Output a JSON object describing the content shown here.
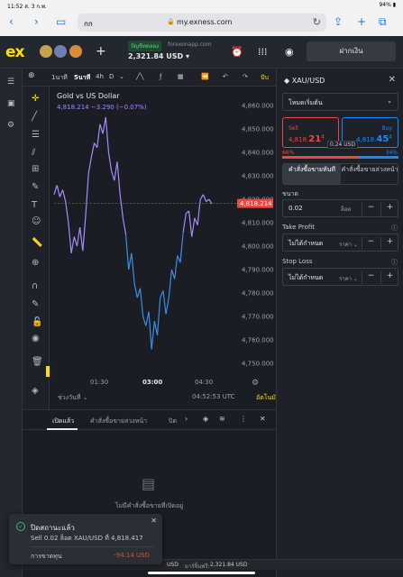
{
  "status": {
    "time": "11:52",
    "date": "ส. 3 ก.พ.",
    "battery": "94%"
  },
  "browser": {
    "aa": "กก",
    "url": "my.exness.com"
  },
  "header": {
    "account_badge": "ปัญชีทดลอง",
    "server": "forexonapp.com",
    "balance": "2,321.84 USD",
    "deposit_label": "ฝากเงิน"
  },
  "toolbar": {
    "tf_1m": "1นาที",
    "tf_5m": "5นาที",
    "tf_4h": "4h",
    "tf_d": "D",
    "right_label": "ปับ"
  },
  "chart": {
    "title": "Gold vs US Dollar",
    "quote": "4,818.214  −3.290 (−0.07%)",
    "time_range_label": "ช่วงวันที่",
    "clock": "04:52:53 UTC",
    "autoscale_label": "อัตโนมัติ",
    "current_price_label": "4,818.214"
  },
  "chart_data": {
    "type": "line",
    "title": "Gold vs US Dollar",
    "x_ticks": [
      "01:30",
      "03:00",
      "04:30"
    ],
    "y_ticks": [
      "4,860.000",
      "4,850.000",
      "4,840.000",
      "4,830.000",
      "4,820.000",
      "4,810.000",
      "4,800.000",
      "4,790.000",
      "4,780.000",
      "4,770.000",
      "4,760.000",
      "4,750.000"
    ],
    "ylim": [
      4745,
      4865
    ],
    "current_price": 4818.214,
    "series": [
      {
        "values": [
          4822,
          4826,
          4821,
          4824,
          4819,
          4810,
          4797,
          4804,
          4800,
          4808,
          4798,
          4813,
          4831,
          4838,
          4844,
          4842,
          4852,
          4848,
          4855,
          4840,
          4832,
          4828,
          4836,
          4822,
          4812,
          4805,
          4790,
          4797,
          4784,
          4778,
          4782,
          4770,
          4766,
          4772,
          4756,
          4768,
          4762,
          4778,
          4781,
          4771,
          4778,
          4790,
          4786,
          4796,
          4793,
          4806,
          4814,
          4815,
          4804,
          4812,
          4809,
          4820,
          4822,
          4819,
          4820,
          4818
        ]
      }
    ]
  },
  "panel": {
    "symbol": "XAU/USD",
    "mode": "โหมดเริ่มต้น",
    "sell_label": "Sell",
    "sell_price_small": "4,818.",
    "sell_price_big": "21",
    "sell_price_sup": "4",
    "buy_label": "Buy",
    "buy_price_small": "4,818.",
    "buy_price_big": "45",
    "buy_price_sup": "4",
    "spread": "0.24 USD",
    "sell_pct": "66%",
    "buy_pct": "34%",
    "sentiment_sell_fraction": 0.66,
    "tab_instant": "คำสั่งซื้อขายทันที",
    "tab_pending": "คำสั่งซื้อขายล่วงหน้า",
    "size_label": "ขนาด",
    "size_value": "0.02",
    "size_unit": "ล็อต",
    "tp_label": "Take Profit",
    "tp_value": "ไม่ได้กำหนด",
    "tp_unit": "ราคา",
    "sl_label": "Stop Loss",
    "sl_value": "ไม่ได้กำหนด",
    "sl_unit": "ราคา"
  },
  "positions": {
    "tab_open": "เปิดแล้ว",
    "tab_pending": "คำสั่งซื้อขายล่วงหน้า",
    "tab_closed": "ปิด",
    "empty_text": "ไม่มีคำสั่งซื้อขายที่เปิดอยู่"
  },
  "bottom_bar": {
    "a": "USD",
    "b": "มาร์จิ้นฟรี:",
    "c": "2,321.84 USD"
  },
  "toast": {
    "title": "ปิดสถานะแล้ว",
    "desc": "Sell 0.02 ล็อต XAU/USD ที่ 4,818.417",
    "pnl_label": "การขาดทุน",
    "pnl_value": "-94.14 USD"
  },
  "colors": {
    "sell": "#eb483f",
    "buy": "#158bf9",
    "brand": "#ffde02",
    "line_up": "#a78bfa",
    "line_down": "#3b8fe0"
  }
}
